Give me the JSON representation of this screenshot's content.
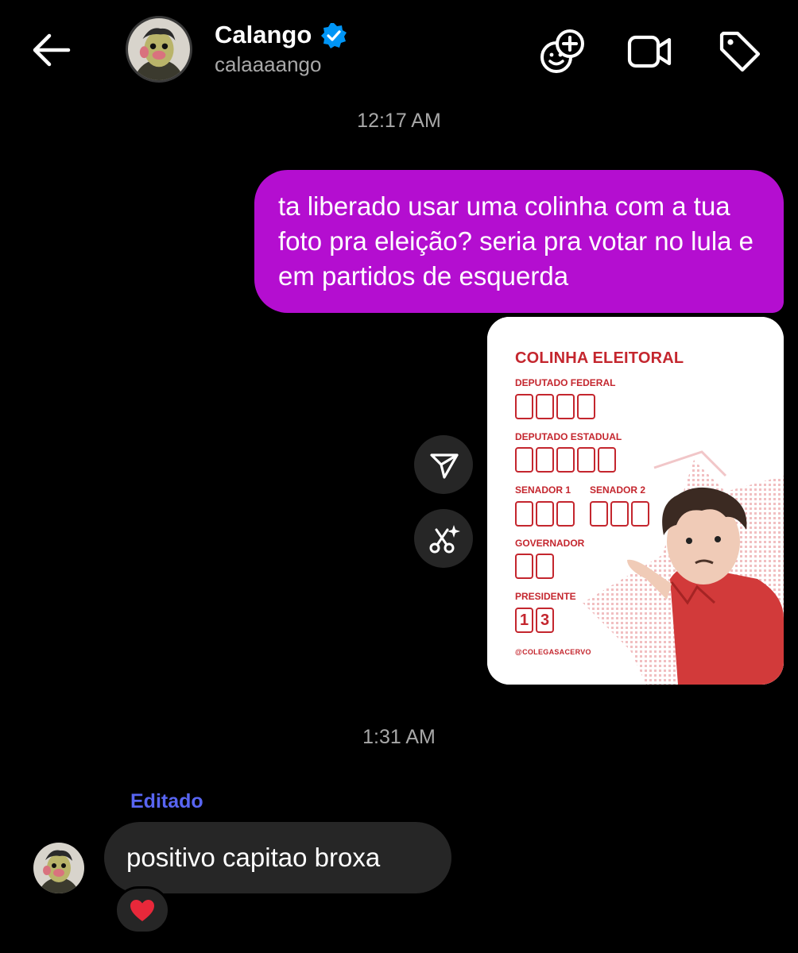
{
  "colors": {
    "background": "#000000",
    "outgoing_bubble": "#b40ed0",
    "incoming_bubble": "#262626",
    "verified": "#0095f6",
    "edited_label": "#5865f2",
    "card_accent": "#c4262e"
  },
  "header": {
    "back_icon": "arrow-left-icon",
    "name": "Calango",
    "verified_icon": "verified-badge-icon",
    "handle": "calaaaango",
    "actions": [
      "add-people-icon",
      "video-call-icon",
      "tag-icon"
    ]
  },
  "messages": {
    "timestamp_1": "12:17 AM",
    "outgoing_text": "ta liberado usar uma colinha com a tua foto pra eleição? seria pra votar no lula e em partidos de esquerda",
    "side_actions": [
      "share-icon",
      "remix-icon"
    ],
    "timestamp_2": "1:31 AM",
    "edited_label": "Editado",
    "incoming_text": "positivo capitao broxa",
    "reaction": "heart-icon"
  },
  "card": {
    "title": "COLINHA ELEITORAL",
    "deputado_federal": "DEPUTADO FEDERAL",
    "deputado_estadual": "DEPUTADO ESTADUAL",
    "senador_1": "SENADOR 1",
    "senador_2": "SENADOR 2",
    "governador": "GOVERNADOR",
    "presidente": "PRESIDENTE",
    "presidente_digit_1": "1",
    "presidente_digit_2": "3",
    "handle": "@COLEGASACERVO"
  }
}
